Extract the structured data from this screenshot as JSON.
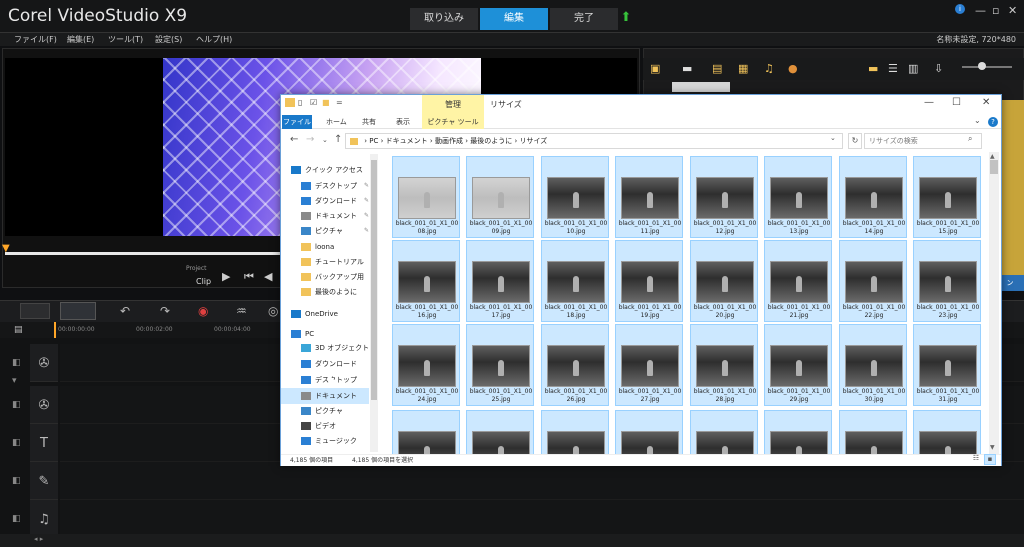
{
  "app": {
    "logo": "Corel VideoStudio X9",
    "mode_tabs": [
      "取り込み",
      "編集",
      "完了"
    ],
    "active_tab": "編集",
    "menu": [
      "ファイル(F)",
      "編集(E)",
      "ツール(T)",
      "設定(S)",
      "ヘルプ(H)"
    ],
    "project_settings": "名称未設定, 720*480",
    "player": {
      "project_label": "Project",
      "clip_label": "Clip"
    },
    "timeline_ruler": [
      "00:00:00:00",
      "00:00:02:00",
      "00:00:04:00"
    ]
  },
  "explorer": {
    "title": "リサイズ",
    "manage_tab": "管理",
    "picture_tools_tab": "ピクチャ ツール",
    "ribbon_tabs": [
      "ファイル",
      "ホーム",
      "共有",
      "表示"
    ],
    "breadcrumb": [
      "PC",
      "ドキュメント",
      "動画作成",
      "最後のように",
      "リサイズ"
    ],
    "search_placeholder": "リサイズの検索",
    "nav": [
      {
        "label": "クイック アクセス",
        "icon": "star-icon",
        "color": "#1979ca",
        "indent": 0
      },
      {
        "label": "デスクトップ",
        "icon": "desktop-icon",
        "color": "#2a7fd4",
        "indent": 1,
        "pinned": true
      },
      {
        "label": "ダウンロード",
        "icon": "download-icon",
        "color": "#2a7fd4",
        "indent": 1,
        "pinned": true
      },
      {
        "label": "ドキュメント",
        "icon": "document-icon",
        "color": "#8a8a8a",
        "indent": 1,
        "pinned": true
      },
      {
        "label": "ピクチャ",
        "icon": "picture-icon",
        "color": "#3a86c8",
        "indent": 1,
        "pinned": true
      },
      {
        "label": "loona",
        "icon": "folder-icon",
        "color": "#f1c35a",
        "indent": 1
      },
      {
        "label": "チュートリアル",
        "icon": "folder-icon",
        "color": "#f1c35a",
        "indent": 1
      },
      {
        "label": "バックアップ用",
        "icon": "folder-icon",
        "color": "#f1c35a",
        "indent": 1
      },
      {
        "label": "最後のように",
        "icon": "folder-icon",
        "color": "#f1c35a",
        "indent": 1
      },
      {
        "label": "OneDrive",
        "icon": "cloud-icon",
        "color": "#1979ca",
        "indent": 0
      },
      {
        "label": "PC",
        "icon": "pc-icon",
        "color": "#2a7fd4",
        "indent": 0
      },
      {
        "label": "3D オブジェクト",
        "icon": "3d-objects-icon",
        "color": "#3aa6d8",
        "indent": 1
      },
      {
        "label": "ダウンロード",
        "icon": "download-icon",
        "color": "#2a7fd4",
        "indent": 1
      },
      {
        "label": "デスクトップ",
        "icon": "desktop-icon",
        "color": "#2a7fd4",
        "indent": 1
      },
      {
        "label": "ドキュメント",
        "icon": "document-icon",
        "color": "#8a8a8a",
        "indent": 1,
        "selected": true
      },
      {
        "label": "ピクチャ",
        "icon": "picture-icon",
        "color": "#3a86c8",
        "indent": 1
      },
      {
        "label": "ビデオ",
        "icon": "video-icon",
        "color": "#444444",
        "indent": 1
      },
      {
        "label": "ミュージック",
        "icon": "music-icon",
        "color": "#2a7fd4",
        "indent": 1
      }
    ],
    "files": [
      {
        "name": "black_001_01_X1_0008.jpg",
        "thumb": "light"
      },
      {
        "name": "black_001_01_X1_0009.jpg",
        "thumb": "light"
      },
      {
        "name": "black_001_01_X1_0010.jpg",
        "thumb": "dark"
      },
      {
        "name": "black_001_01_X1_0011.jpg",
        "thumb": "dark"
      },
      {
        "name": "black_001_01_X1_0012.jpg",
        "thumb": "dark"
      },
      {
        "name": "black_001_01_X1_0013.jpg",
        "thumb": "dark"
      },
      {
        "name": "black_001_01_X1_0014.jpg",
        "thumb": "dark"
      },
      {
        "name": "black_001_01_X1_0015.jpg",
        "thumb": "dark"
      },
      {
        "name": "black_001_01_X1_0016.jpg",
        "thumb": "dark"
      },
      {
        "name": "black_001_01_X1_0017.jpg",
        "thumb": "dark"
      },
      {
        "name": "black_001_01_X1_0018.jpg",
        "thumb": "dark"
      },
      {
        "name": "black_001_01_X1_0019.jpg",
        "thumb": "dark"
      },
      {
        "name": "black_001_01_X1_0020.jpg",
        "thumb": "dark"
      },
      {
        "name": "black_001_01_X1_0021.jpg",
        "thumb": "dark"
      },
      {
        "name": "black_001_01_X1_0022.jpg",
        "thumb": "dark"
      },
      {
        "name": "black_001_01_X1_0023.jpg",
        "thumb": "dark"
      },
      {
        "name": "black_001_01_X1_0024.jpg",
        "thumb": "dark"
      },
      {
        "name": "black_001_01_X1_0025.jpg",
        "thumb": "dark"
      },
      {
        "name": "black_001_01_X1_0026.jpg",
        "thumb": "dark"
      },
      {
        "name": "black_001_01_X1_0027.jpg",
        "thumb": "dark"
      },
      {
        "name": "black_001_01_X1_0028.jpg",
        "thumb": "dark"
      },
      {
        "name": "black_001_01_X1_0029.jpg",
        "thumb": "dark"
      },
      {
        "name": "black_001_01_X1_0030.jpg",
        "thumb": "dark"
      },
      {
        "name": "black_001_01_X1_0031.jpg",
        "thumb": "dark"
      },
      {
        "name": "",
        "thumb": "dark"
      },
      {
        "name": "",
        "thumb": "dark"
      },
      {
        "name": "",
        "thumb": "dark"
      },
      {
        "name": "",
        "thumb": "dark"
      },
      {
        "name": "",
        "thumb": "dark"
      },
      {
        "name": "",
        "thumb": "dark"
      },
      {
        "name": "",
        "thumb": "dark"
      },
      {
        "name": "",
        "thumb": "dark"
      }
    ],
    "status": {
      "item_count": "4,185 個の項目",
      "selected_count": "4,185 個の項目を選択"
    }
  }
}
